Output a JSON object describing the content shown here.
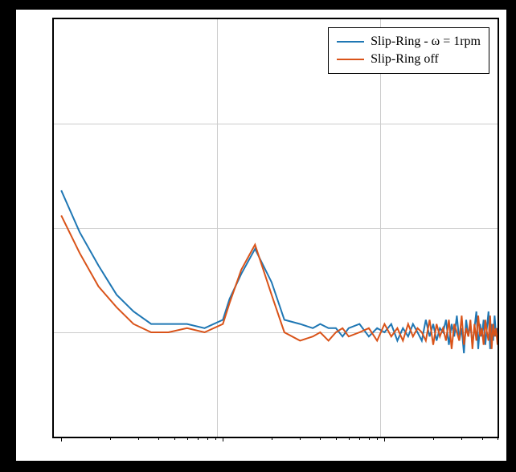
{
  "chart_data": {
    "type": "line",
    "xscale": "log",
    "xlabel": "",
    "ylabel": "",
    "xlim": [
      0.9,
      500
    ],
    "ylim": [
      0,
      1
    ],
    "legend_position": "top-right",
    "grid": true,
    "series": [
      {
        "name": "Slip-Ring - ω = 1rpm",
        "color": "#1f77b4",
        "x": [
          1,
          1.3,
          1.7,
          2.2,
          2.8,
          3.6,
          4.6,
          6,
          7.7,
          10,
          11,
          13,
          15.8,
          20,
          24,
          30,
          36,
          40,
          45,
          50,
          55,
          60,
          70,
          80,
          90,
          100,
          110,
          120,
          130,
          140,
          150,
          160,
          170,
          180,
          190,
          200,
          210,
          220,
          230,
          240,
          250,
          260,
          270,
          280,
          290,
          300,
          310,
          320,
          330,
          340,
          350,
          360,
          370,
          380,
          390,
          400,
          410,
          420,
          430,
          440,
          450,
          460,
          470,
          480,
          490,
          500
        ],
        "y": [
          0.59,
          0.49,
          0.41,
          0.34,
          0.3,
          0.27,
          0.27,
          0.27,
          0.26,
          0.28,
          0.33,
          0.39,
          0.45,
          0.37,
          0.28,
          0.27,
          0.26,
          0.27,
          0.26,
          0.26,
          0.24,
          0.26,
          0.27,
          0.24,
          0.26,
          0.25,
          0.27,
          0.23,
          0.26,
          0.24,
          0.27,
          0.25,
          0.23,
          0.28,
          0.24,
          0.27,
          0.23,
          0.26,
          0.25,
          0.28,
          0.22,
          0.27,
          0.24,
          0.29,
          0.23,
          0.26,
          0.2,
          0.28,
          0.24,
          0.27,
          0.22,
          0.26,
          0.3,
          0.21,
          0.27,
          0.24,
          0.28,
          0.22,
          0.26,
          0.3,
          0.21,
          0.27,
          0.23,
          0.29,
          0.24,
          0.26
        ]
      },
      {
        "name": "Slip-Ring off",
        "color": "#d95319",
        "x": [
          1,
          1.3,
          1.7,
          2.2,
          2.8,
          3.6,
          4.6,
          6,
          7.7,
          10,
          11,
          13,
          15.8,
          20,
          24,
          30,
          36,
          40,
          45,
          50,
          55,
          60,
          70,
          80,
          90,
          100,
          110,
          120,
          130,
          140,
          150,
          160,
          170,
          180,
          190,
          200,
          210,
          220,
          230,
          240,
          250,
          260,
          270,
          280,
          290,
          300,
          310,
          320,
          330,
          340,
          350,
          360,
          370,
          380,
          390,
          400,
          410,
          420,
          430,
          440,
          450,
          460,
          470,
          480,
          490,
          500
        ],
        "y": [
          0.53,
          0.44,
          0.36,
          0.31,
          0.27,
          0.25,
          0.25,
          0.26,
          0.25,
          0.27,
          0.32,
          0.4,
          0.46,
          0.34,
          0.25,
          0.23,
          0.24,
          0.25,
          0.23,
          0.25,
          0.26,
          0.24,
          0.25,
          0.26,
          0.23,
          0.27,
          0.24,
          0.26,
          0.23,
          0.27,
          0.24,
          0.26,
          0.25,
          0.23,
          0.28,
          0.22,
          0.27,
          0.24,
          0.26,
          0.23,
          0.28,
          0.21,
          0.27,
          0.25,
          0.23,
          0.29,
          0.22,
          0.26,
          0.24,
          0.28,
          0.21,
          0.27,
          0.23,
          0.29,
          0.24,
          0.26,
          0.22,
          0.28,
          0.25,
          0.23,
          0.29,
          0.21,
          0.27,
          0.24,
          0.26,
          0.22
        ]
      }
    ]
  },
  "legend": {
    "items": [
      {
        "label": "Slip-Ring - ω = 1rpm",
        "color": "#1f77b4"
      },
      {
        "label": "Slip-Ring off",
        "color": "#d95319"
      }
    ]
  }
}
